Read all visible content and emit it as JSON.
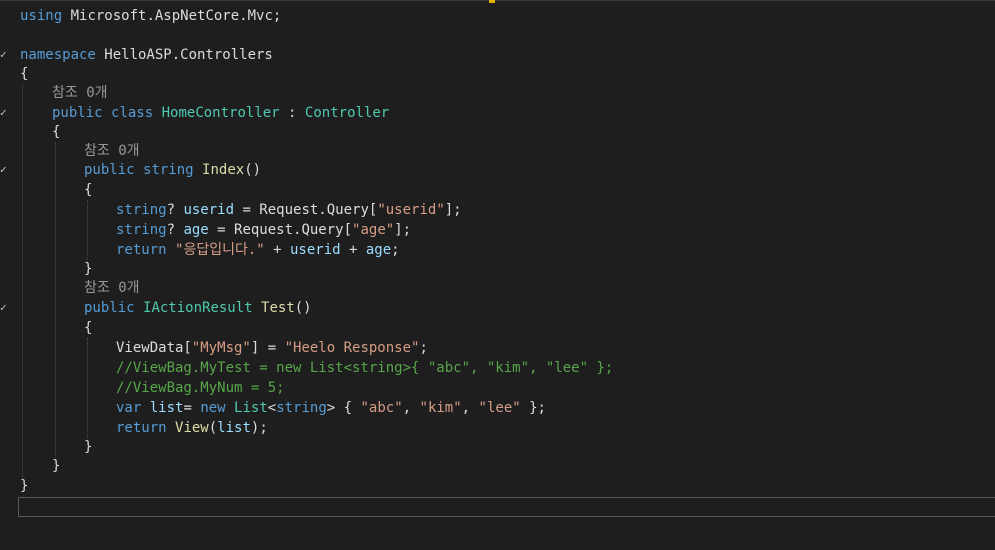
{
  "editor": {
    "lines": [
      {
        "fold": "",
        "segments": [
          {
            "t": "using",
            "c": "kw"
          },
          {
            "t": " Microsoft.AspNetCore.Mvc;",
            "c": "id"
          }
        ]
      },
      {
        "fold": "",
        "segments": []
      },
      {
        "fold": "✓",
        "segments": [
          {
            "t": "namespace",
            "c": "kw"
          },
          {
            "t": " HelloASP.Controllers",
            "c": "id"
          }
        ]
      },
      {
        "fold": "",
        "segments": [
          {
            "t": "{",
            "c": "id"
          }
        ]
      },
      {
        "fold": "",
        "segments": [
          {
            "t": "참조 0개",
            "c": "codelens"
          }
        ]
      },
      {
        "fold": "✓",
        "segments": [
          {
            "t": "public",
            "c": "kw"
          },
          {
            "t": " ",
            "c": "id"
          },
          {
            "t": "class",
            "c": "kw"
          },
          {
            "t": " ",
            "c": "id"
          },
          {
            "t": "HomeController",
            "c": "type"
          },
          {
            "t": " : ",
            "c": "id"
          },
          {
            "t": "Controller",
            "c": "type"
          }
        ]
      },
      {
        "fold": "",
        "segments": [
          {
            "t": "{",
            "c": "id"
          }
        ]
      },
      {
        "fold": "",
        "segments": [
          {
            "t": "참조 0개",
            "c": "codelens"
          }
        ]
      },
      {
        "fold": "✓",
        "segments": [
          {
            "t": "public",
            "c": "kw"
          },
          {
            "t": " ",
            "c": "id"
          },
          {
            "t": "string",
            "c": "kw"
          },
          {
            "t": " ",
            "c": "id"
          },
          {
            "t": "Index",
            "c": "fn"
          },
          {
            "t": "()",
            "c": "id"
          }
        ]
      },
      {
        "fold": "",
        "segments": [
          {
            "t": "{",
            "c": "id"
          }
        ]
      },
      {
        "fold": "",
        "segments": [
          {
            "t": "string",
            "c": "kw"
          },
          {
            "t": "? ",
            "c": "id"
          },
          {
            "t": "userid",
            "c": "var"
          },
          {
            "t": " = Request.Query[",
            "c": "id"
          },
          {
            "t": "\"userid\"",
            "c": "str"
          },
          {
            "t": "];",
            "c": "id"
          }
        ]
      },
      {
        "fold": "",
        "segments": [
          {
            "t": "string",
            "c": "kw"
          },
          {
            "t": "? ",
            "c": "id"
          },
          {
            "t": "age",
            "c": "var"
          },
          {
            "t": " = Request.Query[",
            "c": "id"
          },
          {
            "t": "\"age\"",
            "c": "str"
          },
          {
            "t": "];",
            "c": "id"
          }
        ]
      },
      {
        "fold": "",
        "segments": [
          {
            "t": "return",
            "c": "kw"
          },
          {
            "t": " ",
            "c": "id"
          },
          {
            "t": "\"응답입니다.\"",
            "c": "str"
          },
          {
            "t": " + ",
            "c": "id"
          },
          {
            "t": "userid",
            "c": "var"
          },
          {
            "t": " + ",
            "c": "id"
          },
          {
            "t": "age",
            "c": "var"
          },
          {
            "t": ";",
            "c": "id"
          }
        ]
      },
      {
        "fold": "",
        "segments": [
          {
            "t": "}",
            "c": "id"
          }
        ]
      },
      {
        "fold": "",
        "segments": [
          {
            "t": "참조 0개",
            "c": "codelens"
          }
        ]
      },
      {
        "fold": "✓",
        "segments": [
          {
            "t": "public",
            "c": "kw"
          },
          {
            "t": " ",
            "c": "id"
          },
          {
            "t": "IActionResult",
            "c": "type"
          },
          {
            "t": " ",
            "c": "id"
          },
          {
            "t": "Test",
            "c": "fn"
          },
          {
            "t": "()",
            "c": "id"
          }
        ]
      },
      {
        "fold": "",
        "segments": [
          {
            "t": "{",
            "c": "id"
          }
        ]
      },
      {
        "fold": "",
        "segments": [
          {
            "t": "ViewData[",
            "c": "id"
          },
          {
            "t": "\"MyMsg\"",
            "c": "str"
          },
          {
            "t": "] = ",
            "c": "id"
          },
          {
            "t": "\"Heelo Response\"",
            "c": "str"
          },
          {
            "t": ";",
            "c": "id"
          }
        ]
      },
      {
        "fold": "",
        "segments": [
          {
            "t": "//ViewBag.MyTest = new List<string>{ \"abc\", \"kim\", \"lee\" };",
            "c": "cm"
          }
        ]
      },
      {
        "fold": "",
        "segments": [
          {
            "t": "//ViewBag.MyNum = 5;",
            "c": "cm"
          }
        ]
      },
      {
        "fold": "",
        "segments": [
          {
            "t": "var",
            "c": "kw"
          },
          {
            "t": " ",
            "c": "id"
          },
          {
            "t": "list",
            "c": "var"
          },
          {
            "t": "= ",
            "c": "id"
          },
          {
            "t": "new",
            "c": "kw"
          },
          {
            "t": " ",
            "c": "id"
          },
          {
            "t": "List",
            "c": "type"
          },
          {
            "t": "<",
            "c": "id"
          },
          {
            "t": "string",
            "c": "kw"
          },
          {
            "t": "> { ",
            "c": "id"
          },
          {
            "t": "\"abc\"",
            "c": "str"
          },
          {
            "t": ", ",
            "c": "id"
          },
          {
            "t": "\"kim\"",
            "c": "str"
          },
          {
            "t": ", ",
            "c": "id"
          },
          {
            "t": "\"lee\"",
            "c": "str"
          },
          {
            "t": " };",
            "c": "id"
          }
        ]
      },
      {
        "fold": "",
        "segments": [
          {
            "t": "return",
            "c": "kw"
          },
          {
            "t": " ",
            "c": "id"
          },
          {
            "t": "View",
            "c": "fn"
          },
          {
            "t": "(",
            "c": "id"
          },
          {
            "t": "list",
            "c": "var"
          },
          {
            "t": ");",
            "c": "id"
          }
        ]
      },
      {
        "fold": "",
        "segments": [
          {
            "t": "}",
            "c": "id"
          }
        ]
      },
      {
        "fold": "",
        "segments": [
          {
            "t": "}",
            "c": "id"
          }
        ]
      },
      {
        "fold": "",
        "segments": [
          {
            "t": "}",
            "c": "id"
          }
        ]
      }
    ]
  },
  "colors": {
    "background": "#1e1e1e",
    "keyword": "#569cd6",
    "type": "#4ec9b0",
    "string": "#d69d85",
    "comment": "#57a64a",
    "method": "#dcdcaa",
    "variable": "#9cdcfe",
    "text": "#dcdcdc",
    "codelens": "#999999"
  }
}
